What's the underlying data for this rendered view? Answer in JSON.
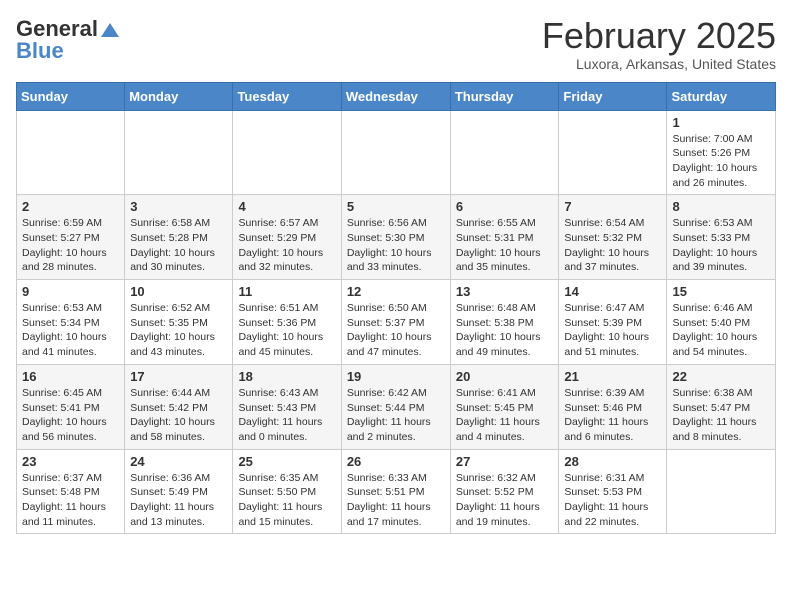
{
  "header": {
    "logo_general": "General",
    "logo_blue": "Blue",
    "month": "February 2025",
    "location": "Luxora, Arkansas, United States"
  },
  "weekdays": [
    "Sunday",
    "Monday",
    "Tuesday",
    "Wednesday",
    "Thursday",
    "Friday",
    "Saturday"
  ],
  "weeks": [
    [
      {
        "day": "",
        "info": ""
      },
      {
        "day": "",
        "info": ""
      },
      {
        "day": "",
        "info": ""
      },
      {
        "day": "",
        "info": ""
      },
      {
        "day": "",
        "info": ""
      },
      {
        "day": "",
        "info": ""
      },
      {
        "day": "1",
        "info": "Sunrise: 7:00 AM\nSunset: 5:26 PM\nDaylight: 10 hours and 26 minutes."
      }
    ],
    [
      {
        "day": "2",
        "info": "Sunrise: 6:59 AM\nSunset: 5:27 PM\nDaylight: 10 hours and 28 minutes."
      },
      {
        "day": "3",
        "info": "Sunrise: 6:58 AM\nSunset: 5:28 PM\nDaylight: 10 hours and 30 minutes."
      },
      {
        "day": "4",
        "info": "Sunrise: 6:57 AM\nSunset: 5:29 PM\nDaylight: 10 hours and 32 minutes."
      },
      {
        "day": "5",
        "info": "Sunrise: 6:56 AM\nSunset: 5:30 PM\nDaylight: 10 hours and 33 minutes."
      },
      {
        "day": "6",
        "info": "Sunrise: 6:55 AM\nSunset: 5:31 PM\nDaylight: 10 hours and 35 minutes."
      },
      {
        "day": "7",
        "info": "Sunrise: 6:54 AM\nSunset: 5:32 PM\nDaylight: 10 hours and 37 minutes."
      },
      {
        "day": "8",
        "info": "Sunrise: 6:53 AM\nSunset: 5:33 PM\nDaylight: 10 hours and 39 minutes."
      }
    ],
    [
      {
        "day": "9",
        "info": "Sunrise: 6:53 AM\nSunset: 5:34 PM\nDaylight: 10 hours and 41 minutes."
      },
      {
        "day": "10",
        "info": "Sunrise: 6:52 AM\nSunset: 5:35 PM\nDaylight: 10 hours and 43 minutes."
      },
      {
        "day": "11",
        "info": "Sunrise: 6:51 AM\nSunset: 5:36 PM\nDaylight: 10 hours and 45 minutes."
      },
      {
        "day": "12",
        "info": "Sunrise: 6:50 AM\nSunset: 5:37 PM\nDaylight: 10 hours and 47 minutes."
      },
      {
        "day": "13",
        "info": "Sunrise: 6:48 AM\nSunset: 5:38 PM\nDaylight: 10 hours and 49 minutes."
      },
      {
        "day": "14",
        "info": "Sunrise: 6:47 AM\nSunset: 5:39 PM\nDaylight: 10 hours and 51 minutes."
      },
      {
        "day": "15",
        "info": "Sunrise: 6:46 AM\nSunset: 5:40 PM\nDaylight: 10 hours and 54 minutes."
      }
    ],
    [
      {
        "day": "16",
        "info": "Sunrise: 6:45 AM\nSunset: 5:41 PM\nDaylight: 10 hours and 56 minutes."
      },
      {
        "day": "17",
        "info": "Sunrise: 6:44 AM\nSunset: 5:42 PM\nDaylight: 10 hours and 58 minutes."
      },
      {
        "day": "18",
        "info": "Sunrise: 6:43 AM\nSunset: 5:43 PM\nDaylight: 11 hours and 0 minutes."
      },
      {
        "day": "19",
        "info": "Sunrise: 6:42 AM\nSunset: 5:44 PM\nDaylight: 11 hours and 2 minutes."
      },
      {
        "day": "20",
        "info": "Sunrise: 6:41 AM\nSunset: 5:45 PM\nDaylight: 11 hours and 4 minutes."
      },
      {
        "day": "21",
        "info": "Sunrise: 6:39 AM\nSunset: 5:46 PM\nDaylight: 11 hours and 6 minutes."
      },
      {
        "day": "22",
        "info": "Sunrise: 6:38 AM\nSunset: 5:47 PM\nDaylight: 11 hours and 8 minutes."
      }
    ],
    [
      {
        "day": "23",
        "info": "Sunrise: 6:37 AM\nSunset: 5:48 PM\nDaylight: 11 hours and 11 minutes."
      },
      {
        "day": "24",
        "info": "Sunrise: 6:36 AM\nSunset: 5:49 PM\nDaylight: 11 hours and 13 minutes."
      },
      {
        "day": "25",
        "info": "Sunrise: 6:35 AM\nSunset: 5:50 PM\nDaylight: 11 hours and 15 minutes."
      },
      {
        "day": "26",
        "info": "Sunrise: 6:33 AM\nSunset: 5:51 PM\nDaylight: 11 hours and 17 minutes."
      },
      {
        "day": "27",
        "info": "Sunrise: 6:32 AM\nSunset: 5:52 PM\nDaylight: 11 hours and 19 minutes."
      },
      {
        "day": "28",
        "info": "Sunrise: 6:31 AM\nSunset: 5:53 PM\nDaylight: 11 hours and 22 minutes."
      },
      {
        "day": "",
        "info": ""
      }
    ]
  ]
}
